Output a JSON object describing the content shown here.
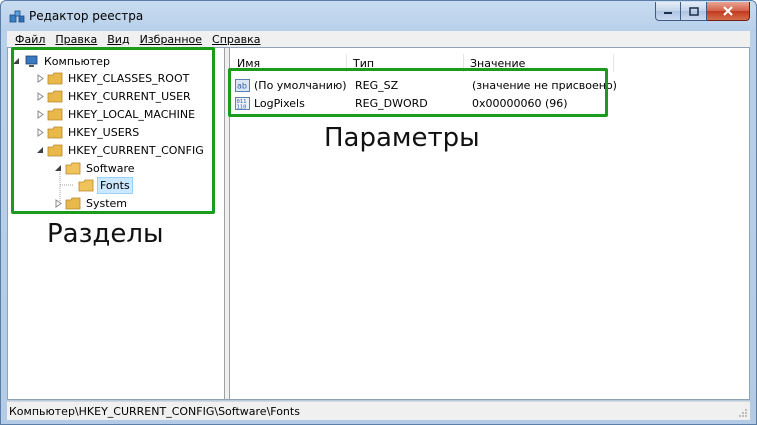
{
  "window": {
    "title": "Редактор реестра",
    "icon": "registry-editor-icon"
  },
  "menubar": {
    "items": [
      "Файл",
      "Правка",
      "Вид",
      "Избранное",
      "Справка"
    ]
  },
  "tree": {
    "root": "Компьютер",
    "items": [
      {
        "label": "HKEY_CLASSES_ROOT",
        "expanded": false
      },
      {
        "label": "HKEY_CURRENT_USER",
        "expanded": false
      },
      {
        "label": "HKEY_LOCAL_MACHINE",
        "expanded": false
      },
      {
        "label": "HKEY_USERS",
        "expanded": false
      },
      {
        "label": "HKEY_CURRENT_CONFIG",
        "expanded": true
      }
    ],
    "software": "Software",
    "fonts": "Fonts",
    "system": "System"
  },
  "list": {
    "columns": [
      "Имя",
      "Тип",
      "Значение"
    ],
    "rows": [
      {
        "name": "(По умолчанию)",
        "type": "REG_SZ",
        "value": "(значение не присвоено)",
        "icon": "string-value-icon"
      },
      {
        "name": "LogPixels",
        "type": "REG_DWORD",
        "value": "0x00000060 (96)",
        "icon": "binary-value-icon"
      }
    ]
  },
  "statusbar": {
    "path": "Компьютер\\HKEY_CURRENT_CONFIG\\Software\\Fonts"
  },
  "annotations": {
    "sections_label": "Разделы",
    "params_label": "Параметры",
    "color": "#1a9c1a"
  }
}
